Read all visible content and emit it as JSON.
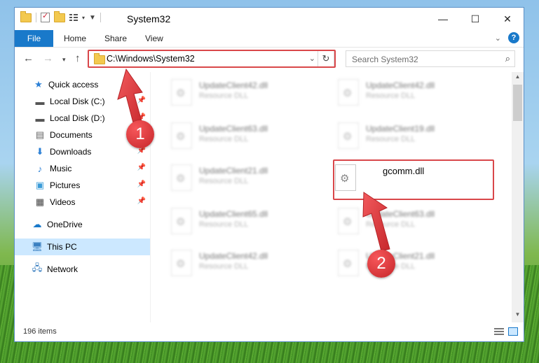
{
  "window": {
    "title": "System32",
    "controls": {
      "minimize": "—",
      "maximize": "☐",
      "close": "✕"
    }
  },
  "ribbon": {
    "tabs": [
      "File",
      "Home",
      "Share",
      "View"
    ],
    "help": "?"
  },
  "nav": {
    "address": "C:\\Windows\\System32",
    "search_placeholder": "Search System32"
  },
  "sidebar": {
    "items": [
      {
        "label": "Quick access",
        "icon": "star-icon",
        "pinned": false
      },
      {
        "label": "Local Disk (C:)",
        "icon": "drive-icon",
        "pinned": true
      },
      {
        "label": "Local Disk (D:)",
        "icon": "drive-icon",
        "pinned": true
      },
      {
        "label": "Documents",
        "icon": "documents-icon",
        "pinned": true
      },
      {
        "label": "Downloads",
        "icon": "download-icon",
        "pinned": true
      },
      {
        "label": "Music",
        "icon": "music-icon",
        "pinned": true
      },
      {
        "label": "Pictures",
        "icon": "pictures-icon",
        "pinned": true
      },
      {
        "label": "Videos",
        "icon": "videos-icon",
        "pinned": true
      },
      {
        "label": "OneDrive",
        "icon": "cloud-icon",
        "pinned": false
      },
      {
        "label": "This PC",
        "icon": "computer-icon",
        "pinned": false,
        "selected": true
      },
      {
        "label": "Network",
        "icon": "network-icon",
        "pinned": false
      }
    ]
  },
  "files": [
    {
      "name": "UpdateClient42.dll",
      "type": "Resource DLL"
    },
    {
      "name": "UpdateClient42.dll",
      "type": "Resource DLL"
    },
    {
      "name": "UpdateClient63.dll",
      "type": "Resource DLL"
    },
    {
      "name": "UpdateClient19.dll",
      "type": "Resource DLL"
    },
    {
      "name": "UpdateClient21.dll",
      "type": "Resource DLL"
    },
    {
      "name": "gcomm.dll",
      "type": ""
    },
    {
      "name": "UpdateClient65.dll",
      "type": "Resource DLL"
    },
    {
      "name": "UpdateClient63.dll",
      "type": "Resource DLL"
    },
    {
      "name": "UpdateClient42.dll",
      "type": "Resource DLL"
    },
    {
      "name": "UpdateClient21.dll",
      "type": "Resource DLL"
    }
  ],
  "status": {
    "item_count": "196 items"
  },
  "markers": {
    "step1": "1",
    "step2": "2"
  },
  "colors": {
    "accent": "#1979ca",
    "highlight": "#d9474a",
    "selected": "#cce8ff"
  }
}
